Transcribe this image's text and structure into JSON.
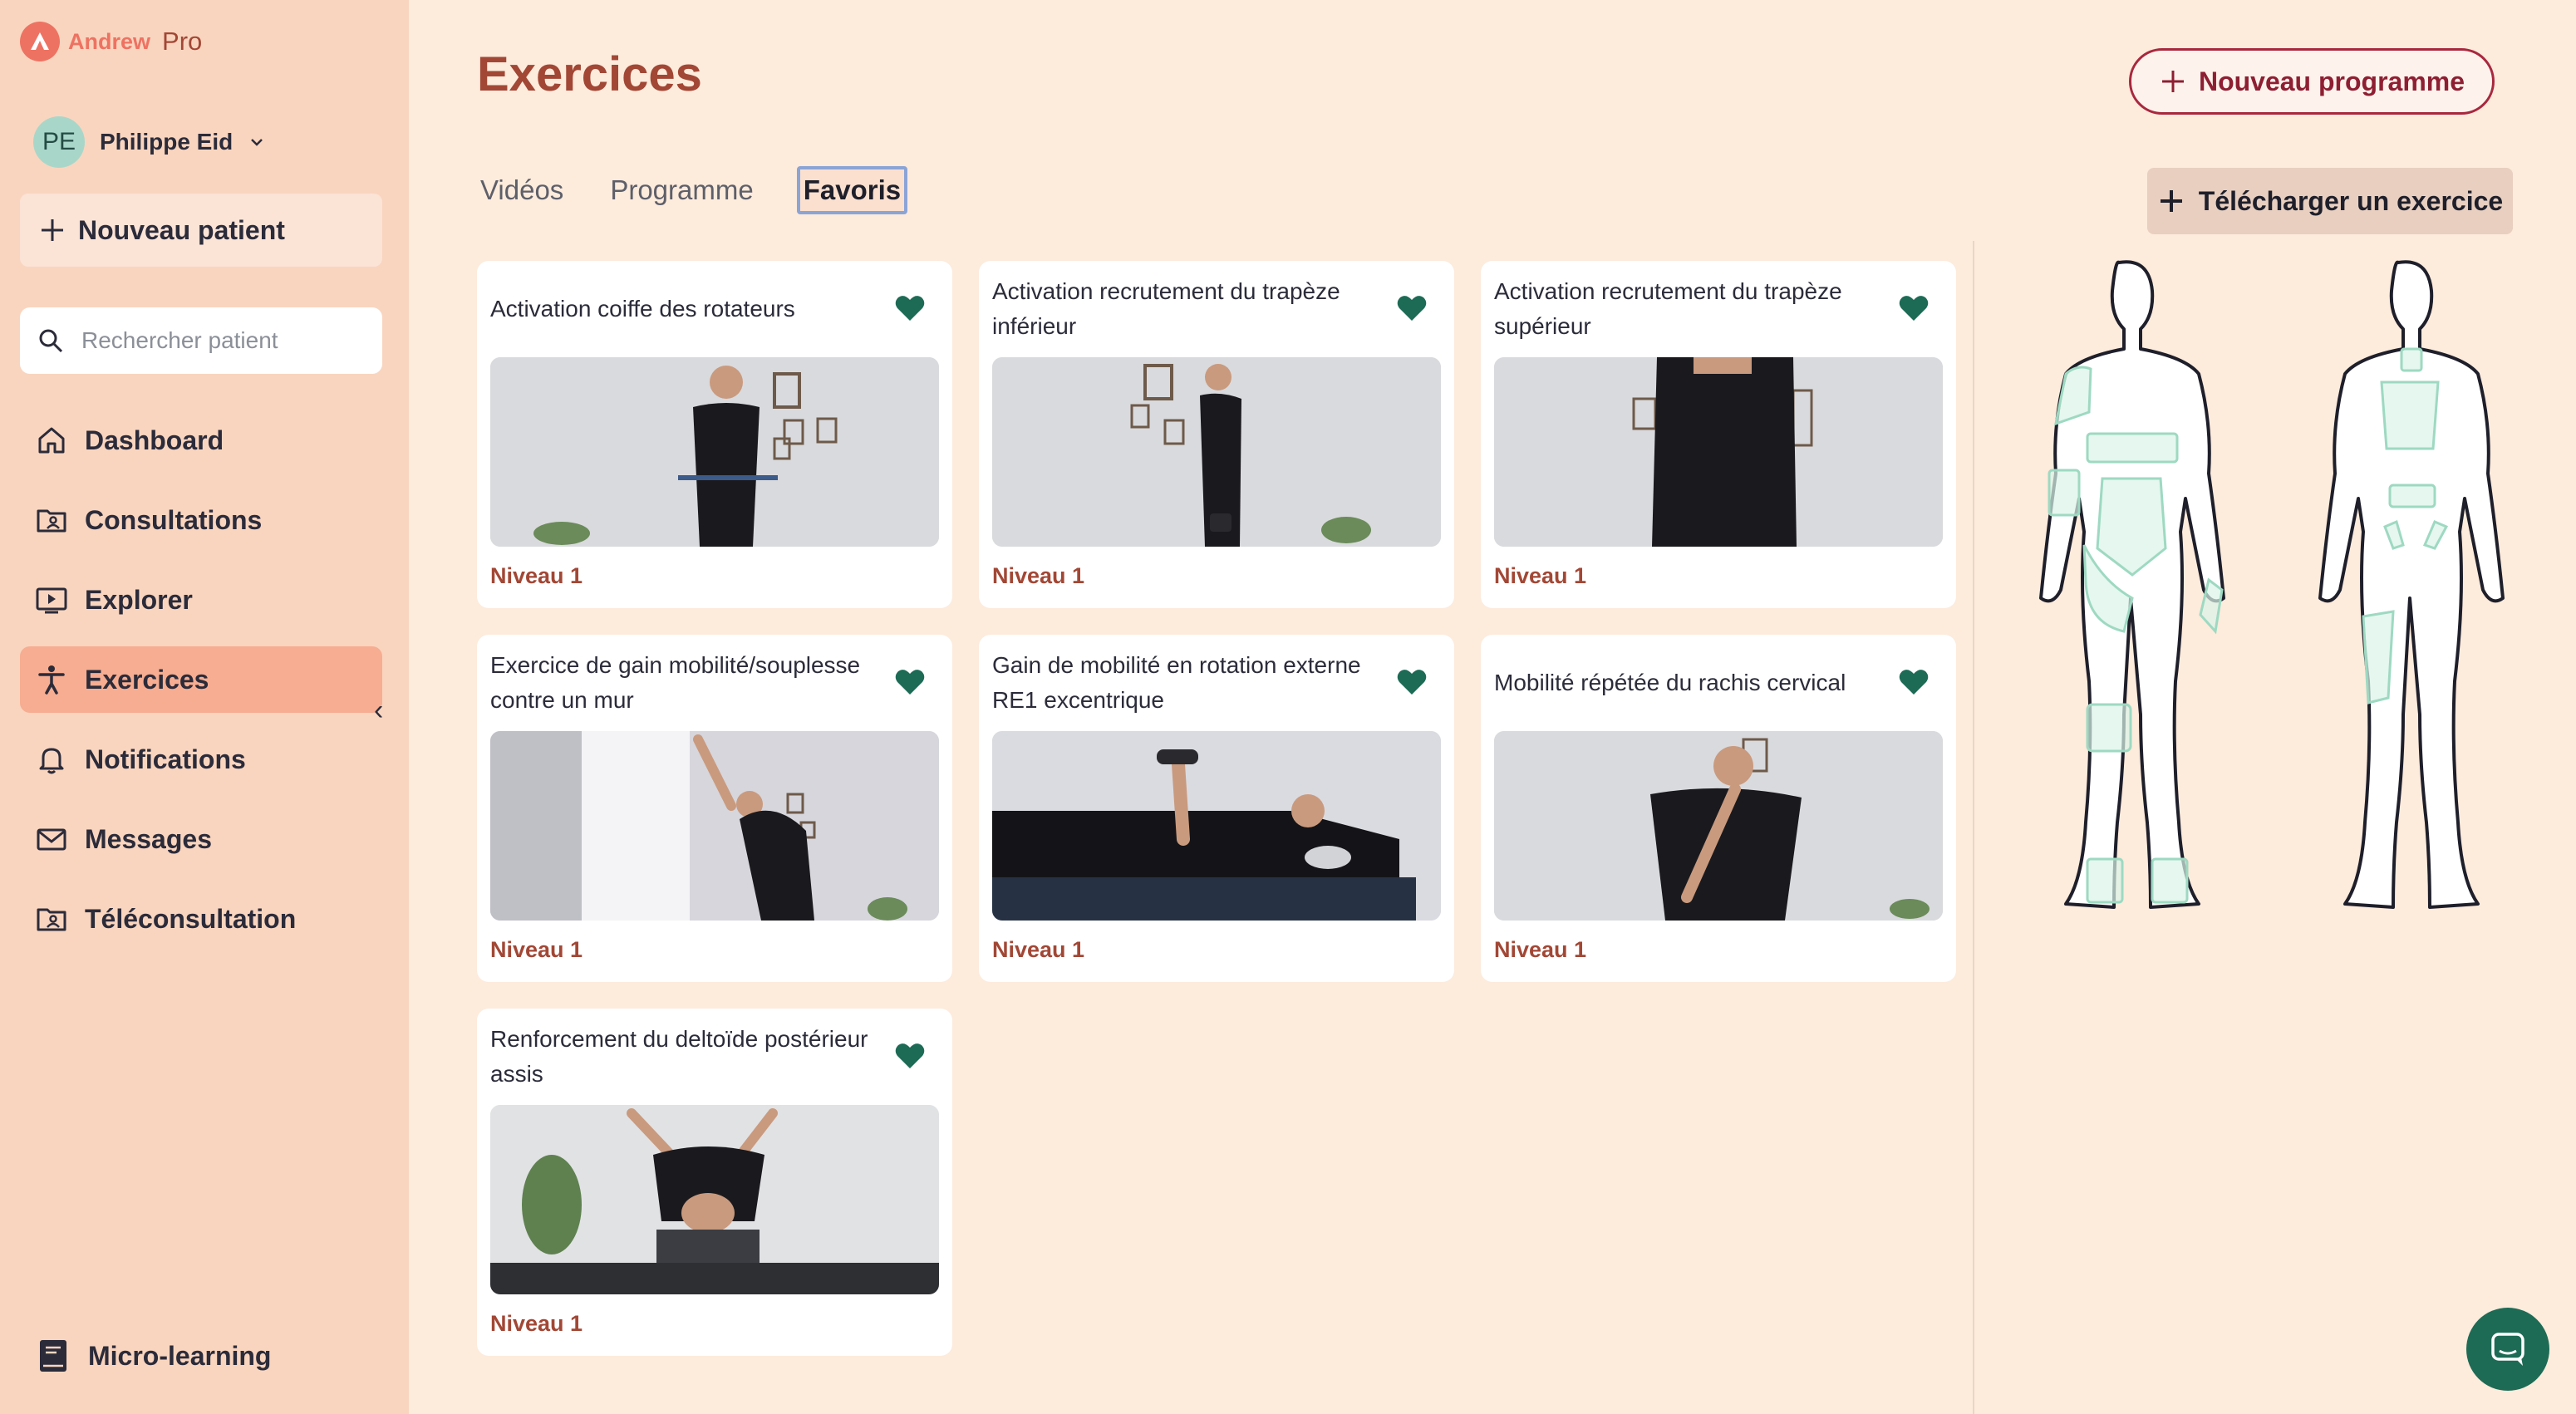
{
  "brand": {
    "name": "Andrew",
    "suffix": "Pro"
  },
  "user": {
    "initials": "PE",
    "name": "Philippe Eid"
  },
  "sidebar": {
    "new_patient": "Nouveau patient",
    "search_placeholder": "Rechercher patient",
    "items": [
      {
        "label": "Dashboard",
        "icon": "home-icon"
      },
      {
        "label": "Consultations",
        "icon": "folder-user-icon"
      },
      {
        "label": "Explorer",
        "icon": "play-screen-icon"
      },
      {
        "label": "Exercices",
        "icon": "person-exercise-icon",
        "active": true
      },
      {
        "label": "Notifications",
        "icon": "bell-icon"
      },
      {
        "label": "Messages",
        "icon": "mail-icon"
      },
      {
        "label": "Téléconsultation",
        "icon": "folder-user-icon"
      }
    ],
    "micro_learning": "Micro-learning"
  },
  "page": {
    "title": "Exercices",
    "new_program": "Nouveau programme",
    "upload": "Télécharger un exercice",
    "tabs": [
      "Vidéos",
      "Programme",
      "Favoris"
    ],
    "selected_tab": "Favoris"
  },
  "exercises": [
    {
      "title": "Activation coiffe des rotateurs",
      "level": "Niveau 1"
    },
    {
      "title": "Activation recrutement du trapèze inférieur",
      "level": "Niveau 1"
    },
    {
      "title": "Activation recrutement du trapèze supérieur",
      "level": "Niveau 1"
    },
    {
      "title": "Exercice de gain mobilité/souplesse contre un mur",
      "level": "Niveau 1"
    },
    {
      "title": "Gain de mobilité en rotation externe RE1 excentrique",
      "level": "Niveau 1"
    },
    {
      "title": "Mobilité répétée du rachis cervical",
      "level": "Niveau 1"
    },
    {
      "title": "Renforcement du deltoïde postérieur assis",
      "level": "Niveau 1"
    }
  ],
  "colors": {
    "accent": "#a24735",
    "heart": "#1d6b55",
    "active_nav": "#f6ad91",
    "sidebar": "#f9d5bf",
    "background": "#fdebdc"
  }
}
